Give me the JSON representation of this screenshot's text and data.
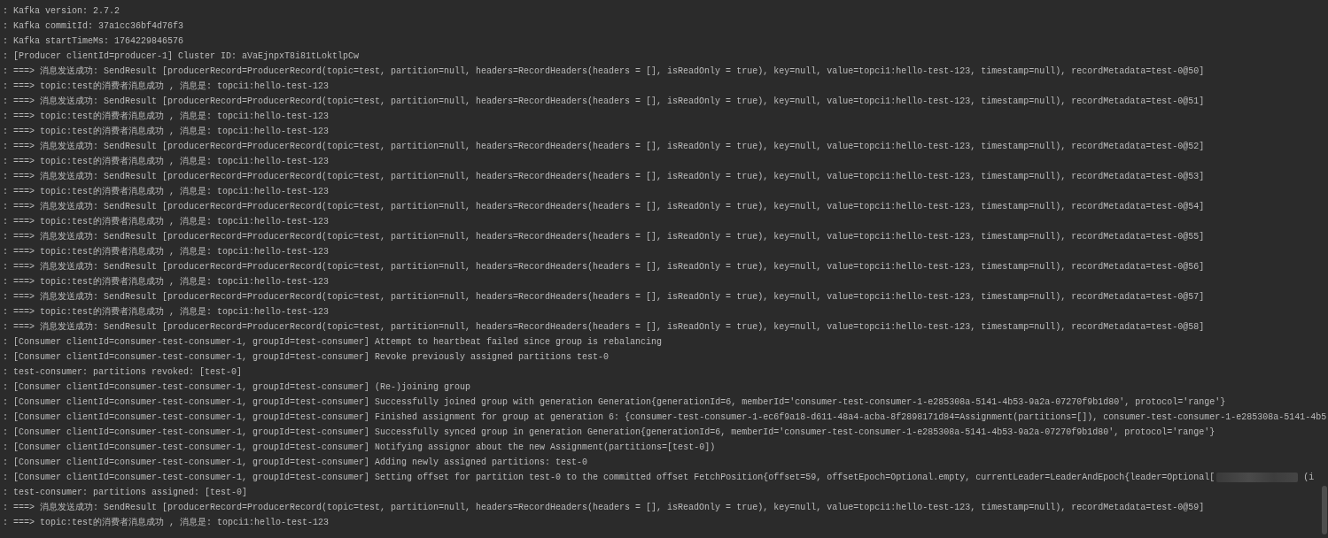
{
  "console": {
    "lines": [
      {
        "text": ": Kafka version: 2.7.2"
      },
      {
        "text": ": Kafka commitId: 37a1cc36bf4d76f3"
      },
      {
        "text": ": Kafka startTimeMs: 1764229846576"
      },
      {
        "text": ": [Producer clientId=producer-1] Cluster ID: aVaEjnpxT8i81tLoktlpCw"
      },
      {
        "text": ": ===> 消息发送成功: SendResult [producerRecord=ProducerRecord(topic=test, partition=null, headers=RecordHeaders(headers = [], isReadOnly = true), key=null, value=topci1:hello-test-123, timestamp=null), recordMetadata=test-0@50]"
      },
      {
        "text": ": ===> topic:test的消费者消息成功 , 消息是: topci1:hello-test-123"
      },
      {
        "text": ": ===> 消息发送成功: SendResult [producerRecord=ProducerRecord(topic=test, partition=null, headers=RecordHeaders(headers = [], isReadOnly = true), key=null, value=topci1:hello-test-123, timestamp=null), recordMetadata=test-0@51]"
      },
      {
        "text": ": ===> topic:test的消费者消息成功 , 消息是: topci1:hello-test-123"
      },
      {
        "text": ": ===> topic:test的消费者消息成功 , 消息是: topci1:hello-test-123"
      },
      {
        "text": ": ===> 消息发送成功: SendResult [producerRecord=ProducerRecord(topic=test, partition=null, headers=RecordHeaders(headers = [], isReadOnly = true), key=null, value=topci1:hello-test-123, timestamp=null), recordMetadata=test-0@52]"
      },
      {
        "text": ": ===> topic:test的消费者消息成功 , 消息是: topci1:hello-test-123"
      },
      {
        "text": ": ===> 消息发送成功: SendResult [producerRecord=ProducerRecord(topic=test, partition=null, headers=RecordHeaders(headers = [], isReadOnly = true), key=null, value=topci1:hello-test-123, timestamp=null), recordMetadata=test-0@53]"
      },
      {
        "text": ": ===> topic:test的消费者消息成功 , 消息是: topci1:hello-test-123"
      },
      {
        "text": ": ===> 消息发送成功: SendResult [producerRecord=ProducerRecord(topic=test, partition=null, headers=RecordHeaders(headers = [], isReadOnly = true), key=null, value=topci1:hello-test-123, timestamp=null), recordMetadata=test-0@54]"
      },
      {
        "text": ": ===> topic:test的消费者消息成功 , 消息是: topci1:hello-test-123"
      },
      {
        "text": ": ===> 消息发送成功: SendResult [producerRecord=ProducerRecord(topic=test, partition=null, headers=RecordHeaders(headers = [], isReadOnly = true), key=null, value=topci1:hello-test-123, timestamp=null), recordMetadata=test-0@55]"
      },
      {
        "text": ": ===> topic:test的消费者消息成功 , 消息是: topci1:hello-test-123"
      },
      {
        "text": ": ===> 消息发送成功: SendResult [producerRecord=ProducerRecord(topic=test, partition=null, headers=RecordHeaders(headers = [], isReadOnly = true), key=null, value=topci1:hello-test-123, timestamp=null), recordMetadata=test-0@56]"
      },
      {
        "text": ": ===> topic:test的消费者消息成功 , 消息是: topci1:hello-test-123"
      },
      {
        "text": ": ===> 消息发送成功: SendResult [producerRecord=ProducerRecord(topic=test, partition=null, headers=RecordHeaders(headers = [], isReadOnly = true), key=null, value=topci1:hello-test-123, timestamp=null), recordMetadata=test-0@57]"
      },
      {
        "text": ": ===> topic:test的消费者消息成功 , 消息是: topci1:hello-test-123"
      },
      {
        "text": ": ===> 消息发送成功: SendResult [producerRecord=ProducerRecord(topic=test, partition=null, headers=RecordHeaders(headers = [], isReadOnly = true), key=null, value=topci1:hello-test-123, timestamp=null), recordMetadata=test-0@58]"
      },
      {
        "text": ": [Consumer clientId=consumer-test-consumer-1, groupId=test-consumer] Attempt to heartbeat failed since group is rebalancing"
      },
      {
        "text": ": [Consumer clientId=consumer-test-consumer-1, groupId=test-consumer] Revoke previously assigned partitions test-0"
      },
      {
        "text": ": test-consumer: partitions revoked: [test-0]"
      },
      {
        "text": ": [Consumer clientId=consumer-test-consumer-1, groupId=test-consumer] (Re-)joining group"
      },
      {
        "text": ": [Consumer clientId=consumer-test-consumer-1, groupId=test-consumer] Successfully joined group with generation Generation{generationId=6, memberId='consumer-test-consumer-1-e285308a-5141-4b53-9a2a-07270f9b1d80', protocol='range'}"
      },
      {
        "text": ": [Consumer clientId=consumer-test-consumer-1, groupId=test-consumer] Finished assignment for group at generation 6: {consumer-test-consumer-1-ec6f9a18-d611-48a4-acba-8f2898171d84=Assignment(partitions=[]), consumer-test-consumer-1-e285308a-5141-4b5"
      },
      {
        "text": ": [Consumer clientId=consumer-test-consumer-1, groupId=test-consumer] Successfully synced group in generation Generation{generationId=6, memberId='consumer-test-consumer-1-e285308a-5141-4b53-9a2a-07270f9b1d80', protocol='range'}"
      },
      {
        "text": ": [Consumer clientId=consumer-test-consumer-1, groupId=test-consumer] Notifying assignor about the new Assignment(partitions=[test-0])"
      },
      {
        "text": ": [Consumer clientId=consumer-test-consumer-1, groupId=test-consumer] Adding newly assigned partitions: test-0"
      },
      {
        "text": ": [Consumer clientId=consumer-test-consumer-1, groupId=test-consumer] Setting offset for partition test-0 to the committed offset FetchPosition{offset=59, offsetEpoch=Optional.empty, currentLeader=LeaderAndEpoch{leader=Optional[",
        "tail": "(i"
      },
      {
        "text": ": test-consumer: partitions assigned: [test-0]"
      },
      {
        "text": ": ===> 消息发送成功: SendResult [producerRecord=ProducerRecord(topic=test, partition=null, headers=RecordHeaders(headers = [], isReadOnly = true), key=null, value=topci1:hello-test-123, timestamp=null), recordMetadata=test-0@59]"
      },
      {
        "text": ": ===> topic:test的消费者消息成功 , 消息是: topci1:hello-test-123"
      }
    ]
  }
}
